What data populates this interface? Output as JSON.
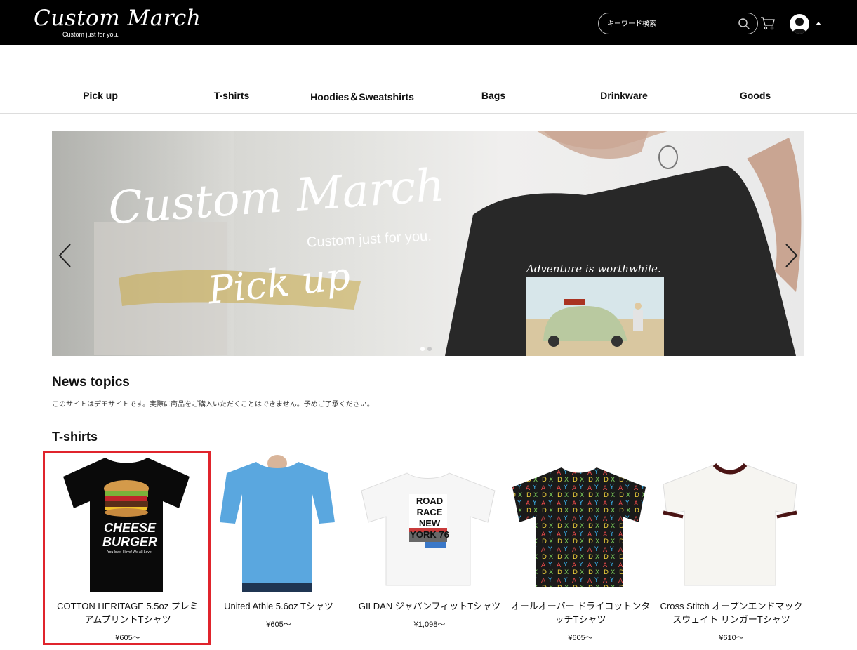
{
  "header": {
    "logo_title": "Custom March",
    "logo_tagline": "Custom just for you.",
    "search_placeholder": "キーワード検索"
  },
  "nav": [
    "Pick up",
    "T-shirts",
    "Hoodies＆Sweatshirts",
    "Bags",
    "Drinkware",
    "Goods"
  ],
  "hero": {
    "title": "Custom March",
    "tagline": "Custom just for you.",
    "subtitle": "Pick up",
    "shirt_text": "Adventure is worthwhile.",
    "active_slide": 1,
    "slide_count": 2
  },
  "news": {
    "heading": "News topics",
    "text": "このサイトはデモサイトです。実際に商品をご購入いただくことはできません。予めご了承ください。"
  },
  "tshirts": {
    "heading": "T-shirts",
    "products": [
      {
        "name": "COTTON HERITAGE 5.5oz プレミアムプリントTシャツ",
        "price": "¥605～",
        "selected": true
      },
      {
        "name": "United Athle 5.6oz Tシャツ",
        "price": "¥605～"
      },
      {
        "name": "GILDAN ジャパンフィットTシャツ",
        "price": "¥1,098～"
      },
      {
        "name": "オールオーバー ドライコットンタッチTシャツ",
        "price": "¥605～"
      },
      {
        "name": "Cross Stitch オープンエンドマックスウェイト リンガーTシャツ",
        "price": "¥610～"
      }
    ],
    "print_cheeseburger": "CHEESE BURGER",
    "print_cheeseburger_small": "You love! I love! We All Love!",
    "print_roadrace": "ROAD RACE NEW YORK 76"
  },
  "colors": {
    "header_bg": "#000000",
    "highlight": "#e0242c",
    "text": "#111111"
  }
}
